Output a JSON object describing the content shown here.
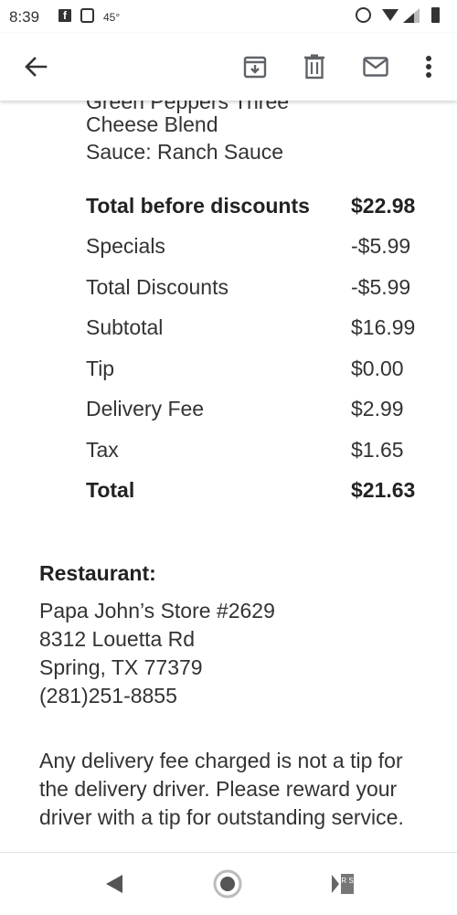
{
  "status_bar": {
    "time": "8:39",
    "temperature": "45°",
    "icons": [
      "facebook-icon",
      "tab-icon",
      "alarm-icon",
      "wifi-icon",
      "signal-icon",
      "battery-icon"
    ]
  },
  "toolbar": {
    "icons": [
      "back-arrow-icon",
      "archive-icon",
      "delete-icon",
      "mark-unread-icon",
      "more-vert-icon"
    ]
  },
  "order_items": {
    "cut_off_line": "Green Peppers Three",
    "cheese_line": "Cheese Blend",
    "sauce_line": "Sauce: Ranch Sauce"
  },
  "totals": [
    {
      "label": "Total before discounts",
      "value": "$22.98",
      "bold": true
    },
    {
      "label": "Specials",
      "value": "-$5.99",
      "bold": false
    },
    {
      "label": "Total Discounts",
      "value": "-$5.99",
      "bold": false
    },
    {
      "label": "Subtotal",
      "value": "$16.99",
      "bold": false
    },
    {
      "label": "Tip",
      "value": "$0.00",
      "bold": false
    },
    {
      "label": "Delivery Fee",
      "value": "$2.99",
      "bold": false
    },
    {
      "label": "Tax",
      "value": "$1.65",
      "bold": false
    },
    {
      "label": "Total",
      "value": "$21.63",
      "bold": true
    }
  ],
  "restaurant": {
    "heading": "Restaurant:",
    "name": "Papa John’s Store #2629",
    "street": "8312 Louetta Rd",
    "city": "Spring, TX 77379",
    "phone": "(281)251-8855"
  },
  "note": "Any delivery fee charged is not a tip for the delivery driver. Please reward your driver with a tip for outstanding service.",
  "nav_bar": {
    "icons": [
      "back-triangle-icon",
      "home-circle-icon",
      "recents-icon"
    ],
    "recents_glyph": "R S"
  },
  "colors": {
    "text": "#333333",
    "toolbar_icon": "#5f6368"
  }
}
